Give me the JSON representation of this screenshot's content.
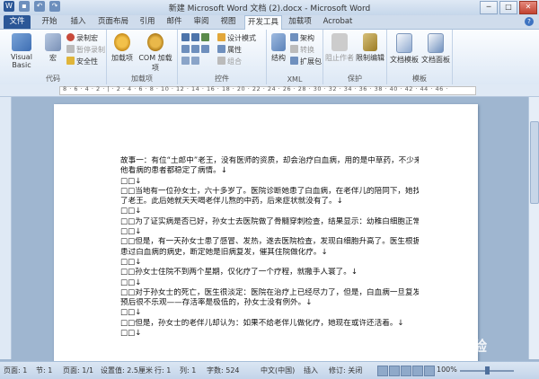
{
  "title": "新建 Microsoft Word 文档 (2).docx - Microsoft Word",
  "window_controls": {
    "minimize": "─",
    "maximize": "□",
    "close": "✕"
  },
  "tabs": [
    "文件",
    "开始",
    "插入",
    "页面布局",
    "引用",
    "邮件",
    "审阅",
    "视图",
    "开发工具",
    "加载项",
    "Acrobat"
  ],
  "active_tab": "开发工具",
  "ribbon": {
    "code": {
      "label": "代码",
      "visual_basic": "Visual Basic",
      "macro": "宏",
      "record_macro": "录制宏",
      "pause_record": "暂停录制",
      "macro_security": "安全性"
    },
    "addins": {
      "label": "加载项",
      "addins": "加载项",
      "com_addins": "COM 加载项"
    },
    "controls": {
      "label": "控件",
      "design_mode": "设计模式",
      "properties": "属性",
      "group": "组合"
    },
    "xml": {
      "label": "XML",
      "structure": "结构",
      "schema": "架构",
      "transform": "转换",
      "expansion_packs": "扩展包"
    },
    "protect": {
      "label": "保护",
      "block_authors": "阻止作者",
      "restrict_editing": "限制编辑"
    },
    "templates": {
      "label": "模板",
      "document_template": "文档模板",
      "document_panel": "文档面板"
    }
  },
  "ruler": {
    "ticks": "8 · 6 · 4 · 2 · | · 2 · 4 · 6 · 8 · 10 · 12 · 14 · 16 · 18 · 20 · 22 · 24 · 26 · 28 · 30 · 32 · 34 · 36 · 38 · 40 · 42 · 44 · 46 ·"
  },
  "document_lines": [
    "故事一：有位“土郎中”老王，没有医师的资质，却会治疗白血病，用的是中草药，不少来找",
    "他看病的患者都稳定了病情。↓",
    "□□↓",
    "□□当地有一位孙女士，六十多岁了。医院诊断她患了白血病，在老伴儿的陪同下，她找到",
    "了老王。此后她就天天喝老伴儿熬的中药，后来症状就没有了。↓",
    "□□↓",
    "□□为了证实病是否已好，孙女士去医院做了骨髓穿刺检查，结果显示：幼稚白细胞正常。↓",
    "□□↓",
    "□□但是，有一天孙女士患了感冒、发热，遂去医院检查，发现白细胞升高了。医生根据她",
    "患过白血病的病史，断定她是旧病复发，催其住院做化疗。↓",
    "□□↓",
    "□□孙女士住院不到两个星期，仅化疗了一个疗程，就撒手人寰了。↓",
    "□□↓",
    "□□对于孙女士的死亡，医生很淡定：医院在治疗上已经尽力了，但是，白血病一旦复发后",
    "预后很不乐观——存活率是极低的，孙女士没有例外。↓",
    "□□↓",
    "□□但是，孙女士的老伴儿却认为：如果不给老伴儿做化疗，她现在或许还活着。↓",
    "□□↓"
  ],
  "status": {
    "page": "页面: 1",
    "section": "节: 1",
    "pages": "页面: 1/1",
    "position": "设置值: 2.5厘米",
    "row": "行: 1",
    "column": "列: 1",
    "words": "字数: 524",
    "language": "中文(中国)",
    "insert": "插入",
    "revisions": "修订: 关闭",
    "zoom": "100%"
  },
  "watermark": "Bai 经验",
  "colors": {
    "file_tab": "#2b5797",
    "ribbon_bg": "#dde8f5",
    "workspace": "#9fb6d0"
  }
}
